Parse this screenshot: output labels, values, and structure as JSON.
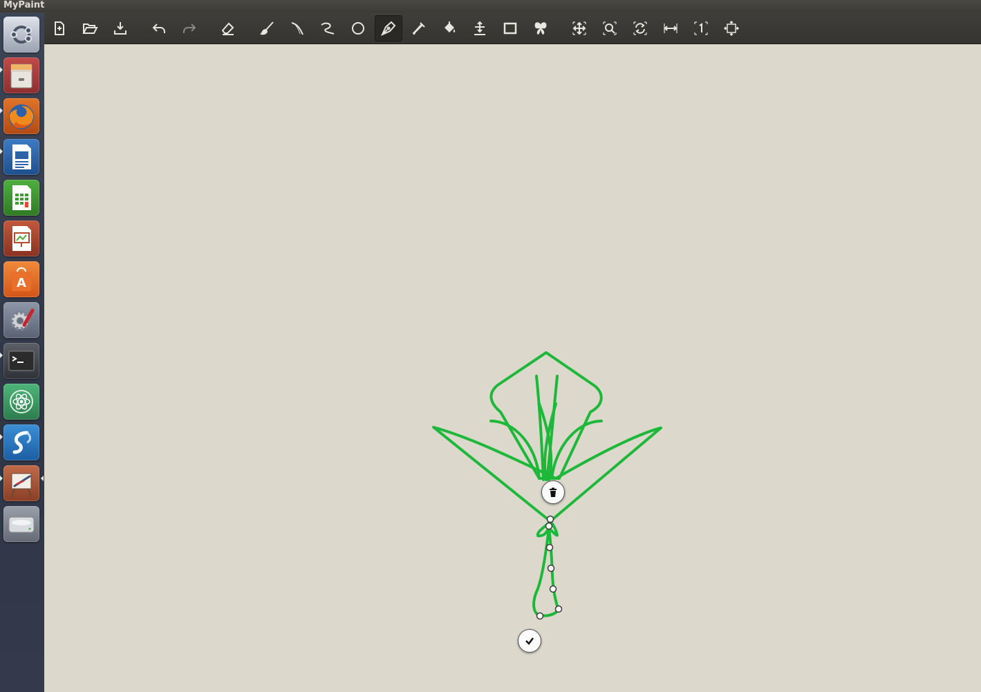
{
  "window": {
    "title": "MyPaint"
  },
  "launcher": {
    "items": [
      {
        "name": "ubuntu-dash",
        "icon": "ubuntu-logo-icon"
      },
      {
        "name": "files",
        "icon": "file-cabinet-icon"
      },
      {
        "name": "firefox",
        "icon": "firefox-icon"
      },
      {
        "name": "libreoffice-writer",
        "icon": "writer-document-icon"
      },
      {
        "name": "libreoffice-calc",
        "icon": "calc-spreadsheet-icon"
      },
      {
        "name": "libreoffice-impress",
        "icon": "impress-presentation-icon"
      },
      {
        "name": "software-center",
        "icon": "shopping-bag-icon"
      },
      {
        "name": "system-settings",
        "icon": "gear-wrench-icon"
      },
      {
        "name": "terminal",
        "icon": "terminal-icon"
      },
      {
        "name": "atom",
        "icon": "atom-icon"
      },
      {
        "name": "app",
        "icon": "blue-swirl-icon"
      },
      {
        "name": "mypaint",
        "icon": "easel-brush-icon"
      },
      {
        "name": "disk",
        "icon": "hard-disk-icon"
      }
    ]
  },
  "toolbar": {
    "buttons": [
      {
        "name": "new-document",
        "icon": "new-document-icon"
      },
      {
        "name": "open-file",
        "icon": "folder-open-icon"
      },
      {
        "name": "save-file",
        "icon": "save-download-icon"
      },
      {
        "name": "undo",
        "icon": "undo-arrow-icon"
      },
      {
        "name": "redo",
        "icon": "redo-arrow-icon"
      },
      {
        "name": "eraser",
        "icon": "eraser-icon"
      },
      {
        "name": "freehand-brush",
        "icon": "paintbrush-icon"
      },
      {
        "name": "inking",
        "icon": "ink-curve-icon"
      },
      {
        "name": "lines-curves",
        "icon": "line-curve-icon"
      },
      {
        "name": "ellipses",
        "icon": "ellipse-icon"
      },
      {
        "name": "pen-tool",
        "icon": "pen-nib-icon",
        "active": true
      },
      {
        "name": "color-picker",
        "icon": "eyedropper-icon"
      },
      {
        "name": "fill",
        "icon": "paint-bucket-icon"
      },
      {
        "name": "move-layer",
        "icon": "move-cross-icon"
      },
      {
        "name": "frame",
        "icon": "frame-rectangle-icon"
      },
      {
        "name": "symmetry",
        "icon": "butterfly-icon"
      },
      {
        "name": "pan-view",
        "icon": "pan-arrows-icon"
      },
      {
        "name": "zoom-view",
        "icon": "magnifier-icon"
      },
      {
        "name": "rotate-view",
        "icon": "rotate-icon"
      },
      {
        "name": "mirror-view",
        "icon": "mirror-horizontal-icon"
      },
      {
        "name": "reset-zoom",
        "icon": "one-to-one-icon"
      },
      {
        "name": "fit-view",
        "icon": "fit-screen-icon"
      }
    ]
  },
  "canvas": {
    "stroke_color": "#1db83a",
    "delete_button_icon": "trash-icon",
    "accept_button_icon": "checkmark-icon"
  }
}
